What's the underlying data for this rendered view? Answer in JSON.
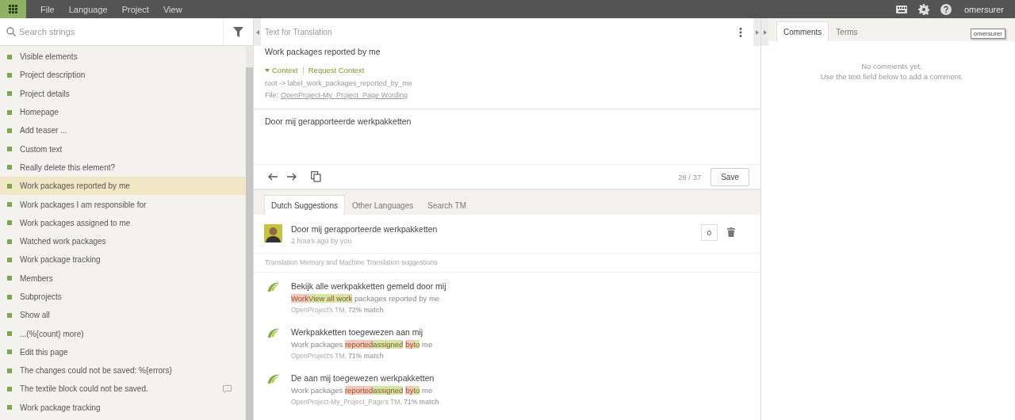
{
  "menu": [
    "File",
    "Language",
    "Project",
    "View"
  ],
  "user": {
    "name": "omersurer",
    "tooltip": "omersurer"
  },
  "search": {
    "placeholder": "Search strings"
  },
  "strings": [
    {
      "label": "Visible elements",
      "selected": false,
      "comment": false
    },
    {
      "label": "Project description",
      "selected": false,
      "comment": false
    },
    {
      "label": "Project details",
      "selected": false,
      "comment": false
    },
    {
      "label": "Homepage",
      "selected": false,
      "comment": false
    },
    {
      "label": "Add teaser ...",
      "selected": false,
      "comment": false
    },
    {
      "label": "Custom text",
      "selected": false,
      "comment": false
    },
    {
      "label": "Really delete this element?",
      "selected": false,
      "comment": false
    },
    {
      "label": "Work packages reported by me",
      "selected": true,
      "comment": false
    },
    {
      "label": "Work packages I am responsible for",
      "selected": false,
      "comment": false
    },
    {
      "label": "Work packages assigned to me",
      "selected": false,
      "comment": false
    },
    {
      "label": "Watched work packages",
      "selected": false,
      "comment": false
    },
    {
      "label": "Work package tracking",
      "selected": false,
      "comment": false
    },
    {
      "label": "Members",
      "selected": false,
      "comment": false
    },
    {
      "label": "Subprojects",
      "selected": false,
      "comment": false
    },
    {
      "label": "Show all",
      "selected": false,
      "comment": false
    },
    {
      "label": "...(%{count} more)",
      "selected": false,
      "comment": false
    },
    {
      "label": "Edit this page",
      "selected": false,
      "comment": false
    },
    {
      "label": "The changes could not be saved: %{errors}",
      "selected": false,
      "comment": false
    },
    {
      "label": "The textile block could not be saved.",
      "selected": false,
      "comment": true
    },
    {
      "label": "Work package tracking",
      "selected": false,
      "comment": false
    }
  ],
  "source": {
    "heading": "Text for Translation",
    "text": "Work packages reported by me",
    "context_toggle": "Context",
    "request_context": "Request Context",
    "key": "root -> label_work_packages_reported_by_me",
    "file_label": "File:",
    "file": "OpenProject-My_Project_Page Wording"
  },
  "translation": {
    "value": "Door mij gerapporteerde werkpakketten",
    "progress": "28 / 37",
    "save": "Save"
  },
  "suggestion_tabs": [
    {
      "label": "Dutch Suggestions",
      "selected": true
    },
    {
      "label": "Other Languages",
      "selected": false
    },
    {
      "label": "Search TM",
      "selected": false
    }
  ],
  "own_suggestion": {
    "text": "Door mij gerapporteerde werkpakketten",
    "meta": "2 hours ago by you",
    "votes": "0"
  },
  "tm_heading": "Translation Memory and Machine Translation suggestions",
  "tm_suggestions": [
    {
      "text": "Bekijk alle werkpakketten gemeld door mij",
      "diff": [
        {
          "kind": "del",
          "text": "Work"
        },
        {
          "kind": "ins",
          "text": "View all work"
        },
        {
          "kind": "same",
          "text": " packages reported by me"
        }
      ],
      "source": "OpenProject's TM, ",
      "match": "72% match"
    },
    {
      "text": "Werkpakketten toegewezen aan mij",
      "diff": [
        {
          "kind": "same",
          "text": "Work packages "
        },
        {
          "kind": "del",
          "text": "reported"
        },
        {
          "kind": "ins",
          "text": "assigned"
        },
        {
          "kind": "del",
          "text": "by",
          "space_before": true
        },
        {
          "kind": "ins",
          "text": "to"
        },
        {
          "kind": "same",
          "text": " me"
        }
      ],
      "source": "OpenProject's TM, ",
      "match": "71% match"
    },
    {
      "text": "De aan mij toegewezen werkpakketten",
      "diff": [
        {
          "kind": "same",
          "text": "Work packages "
        },
        {
          "kind": "del",
          "text": "reported"
        },
        {
          "kind": "ins",
          "text": "assigned"
        },
        {
          "kind": "del",
          "text": "by",
          "space_before": true
        },
        {
          "kind": "ins",
          "text": "to"
        },
        {
          "kind": "same",
          "text": " me"
        }
      ],
      "source": "OpenProject-My_Project_Page's TM, ",
      "match": "71% match"
    }
  ],
  "side_tabs": [
    {
      "label": "Comments",
      "selected": true
    },
    {
      "label": "Terms",
      "selected": false
    }
  ],
  "comments_empty": [
    "No comments yet.",
    "Use the text field below to add a comment."
  ]
}
